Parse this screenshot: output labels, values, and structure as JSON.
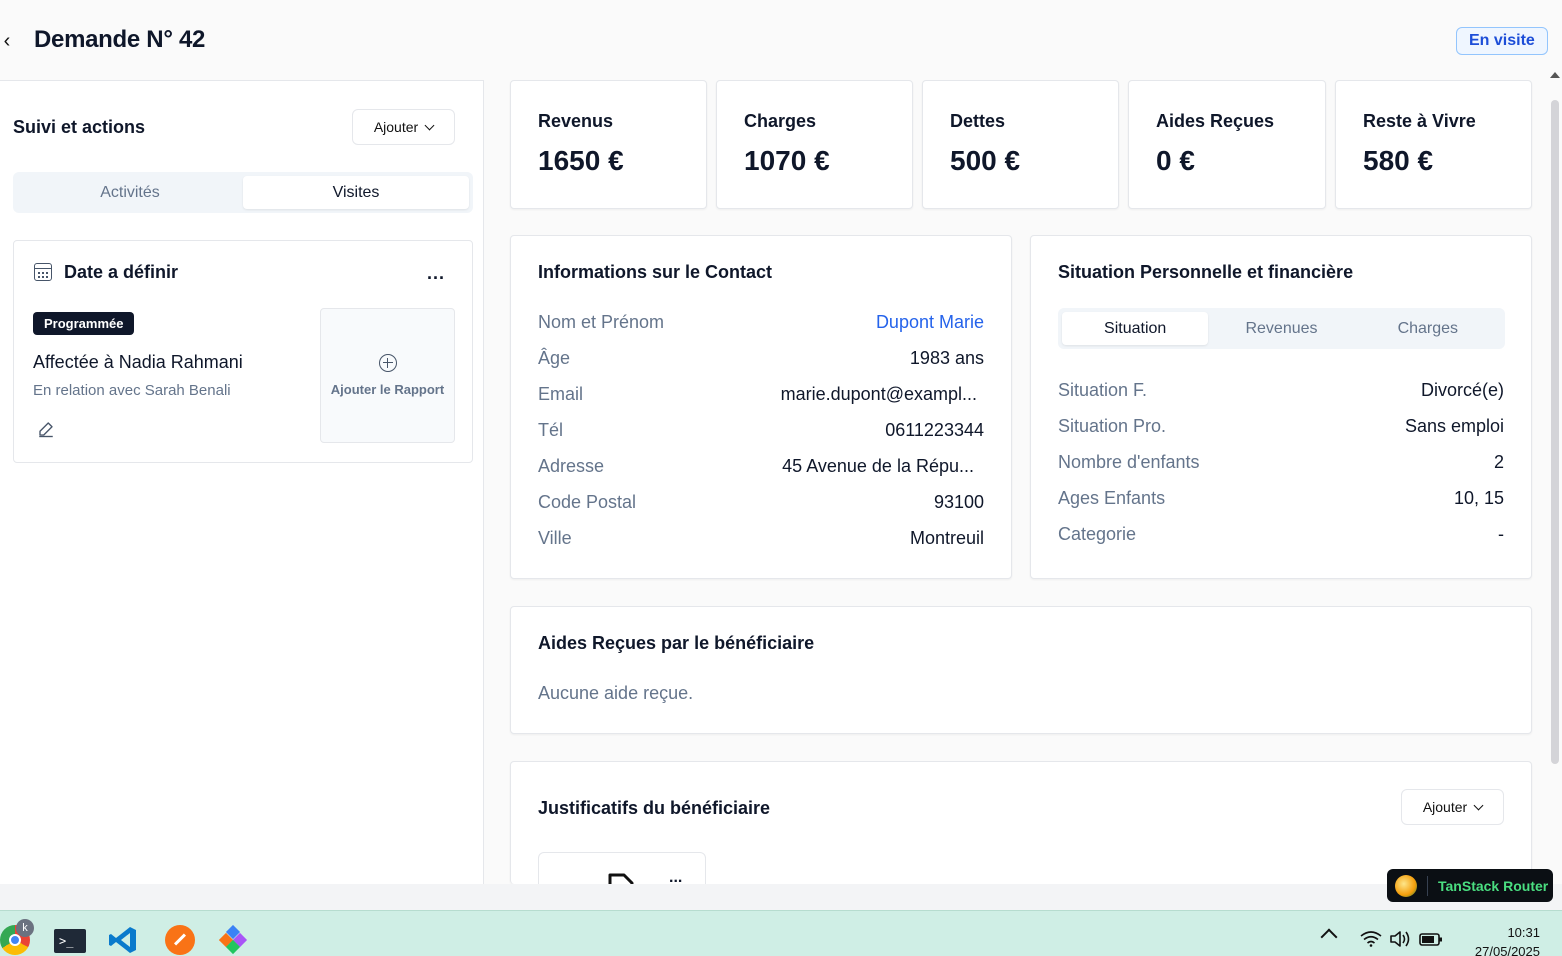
{
  "header": {
    "title": "Demande N° 42",
    "status": "En visite"
  },
  "suivi": {
    "title": "Suivi et actions",
    "add_label": "Ajouter",
    "tabs": [
      {
        "label": "Activités",
        "active": false
      },
      {
        "label": "Visites",
        "active": true
      }
    ],
    "visit": {
      "title": "Date a définir",
      "menu": "...",
      "badge": "Programmée",
      "assigned": "Affectée à Nadia Rahmani",
      "relation": "En relation avec Sarah Benali",
      "add_report": "Ajouter le Rapport"
    }
  },
  "stats": [
    {
      "label": "Revenus",
      "value": "1650 €"
    },
    {
      "label": "Charges",
      "value": "1070 €"
    },
    {
      "label": "Dettes",
      "value": "500 €"
    },
    {
      "label": "Aides Reçues",
      "value": "0 €"
    },
    {
      "label": "Reste à Vivre",
      "value": "580 €"
    }
  ],
  "contact": {
    "title": "Informations sur le Contact",
    "rows": [
      {
        "k": "Nom et Prénom",
        "v": "Dupont Marie"
      },
      {
        "k": "Âge",
        "v": "1983 ans"
      },
      {
        "k": "Email",
        "v": "marie.dupont@exampl..."
      },
      {
        "k": "Tél",
        "v": "0611223344"
      },
      {
        "k": "Adresse",
        "v": "45 Avenue de la Répu..."
      },
      {
        "k": "Code Postal",
        "v": "93100"
      },
      {
        "k": "Ville",
        "v": "Montreuil"
      }
    ]
  },
  "situation": {
    "title": "Situation Personnelle et financière",
    "tabs": [
      {
        "label": "Situation",
        "active": true
      },
      {
        "label": "Revenues",
        "active": false
      },
      {
        "label": "Charges",
        "active": false
      }
    ],
    "rows": [
      {
        "k": "Situation F.",
        "v": "Divorcé(e)"
      },
      {
        "k": "Situation Pro.",
        "v": "Sans emploi"
      },
      {
        "k": "Nombre d'enfants",
        "v": "2"
      },
      {
        "k": "Ages Enfants",
        "v": "10, 15"
      },
      {
        "k": "Categorie",
        "v": "-"
      }
    ]
  },
  "aides": {
    "title": "Aides Reçues par le bénéficiaire",
    "empty": "Aucune aide reçue."
  },
  "justificatifs": {
    "title": "Justificatifs du bénéficiaire",
    "add_label": "Ajouter",
    "doc_menu": "..."
  },
  "devtools": {
    "label": "TanStack Router"
  },
  "taskbar": {
    "time": "10:31",
    "date": "27/05/2025",
    "chrome_badge": "k"
  },
  "colors": {
    "accent": "#2563eb",
    "badge_bg": "#0f172a",
    "taskbar_bg": "#cfeee5",
    "devtools_text": "#4ade80"
  }
}
